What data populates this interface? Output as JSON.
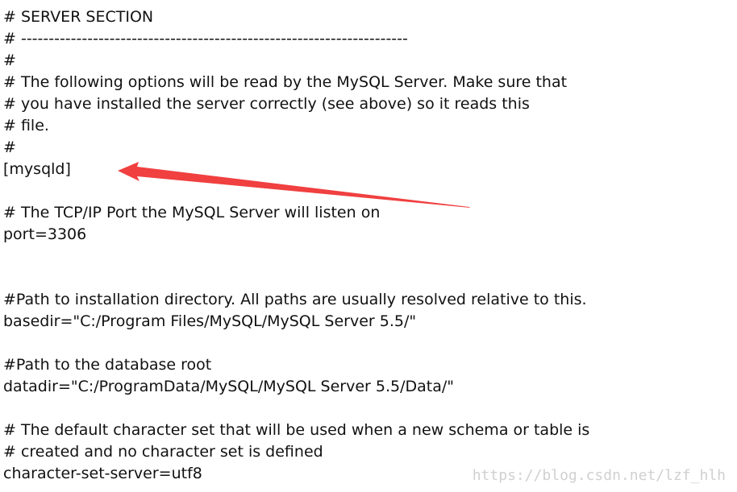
{
  "config_lines": [
    "# SERVER SECTION",
    "# ----------------------------------------------------------------------",
    "#",
    "# The following options will be read by the MySQL Server. Make sure that",
    "# you have installed the server correctly (see above) so it reads this",
    "# file.",
    "#",
    "[mysqld]",
    "",
    "# The TCP/IP Port the MySQL Server will listen on",
    "port=3306",
    "",
    "",
    "#Path to installation directory. All paths are usually resolved relative to this.",
    "basedir=\"C:/Program Files/MySQL/MySQL Server 5.5/\"",
    "",
    "#Path to the database root",
    "datadir=\"C:/ProgramData/MySQL/MySQL Server 5.5/Data/\"",
    "",
    "# The default character set that will be used when a new schema or table is",
    "# created and no character set is defined",
    "character-set-server=utf8"
  ],
  "watermark": "https://blog.csdn.net/lzf_hlh",
  "annotation": {
    "arrow_color": "#f04040",
    "points_to_line": "[mysqld]"
  }
}
